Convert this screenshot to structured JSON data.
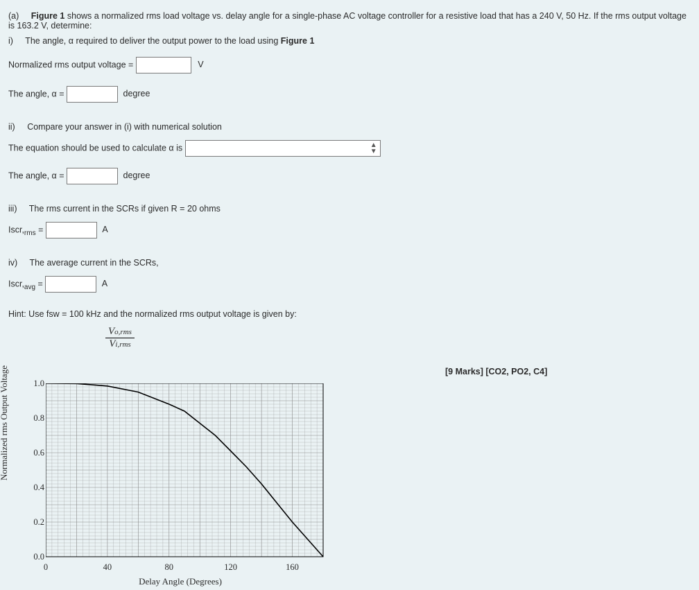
{
  "intro": {
    "label_a": "(a)",
    "text1_prefix": " shows a normalized rms load voltage vs. delay angle for a single-phase AC voltage controller for a resistive load that has a 240 V, 50 Hz. If the rms output voltage is 163.2 V, determine:",
    "fig1": "Figure 1"
  },
  "parts": {
    "i": {
      "label": "i)",
      "text": "The angle, α required to deliver the output power to the load using ",
      "fig": "Figure 1"
    },
    "norm_label": "Normalized rms output voltage = ",
    "norm_unit": "V",
    "angle_label": "The angle, α = ",
    "angle_unit": "degree",
    "ii": {
      "label": "ii)",
      "text": "Compare your answer in (i) with numerical solution"
    },
    "eq_label": "The equation should be used to calculate α is ",
    "iii": {
      "label": "iii)",
      "text": "The rms current in the SCRs if given R = 20 ohms"
    },
    "iscr_rms_label": "Iscr,",
    "iscr_rms_sub": "rms",
    "iscr_rms_post": " = ",
    "iv": {
      "label": "iv)",
      "text": "The average current in the SCRs,"
    },
    "iscr_avg_label": "Iscr,",
    "iscr_avg_sub": "avg",
    "iscr_avg_post": " = ",
    "A": "A"
  },
  "hint": {
    "text": "Hint: Use fsw = 100 kHz and the normalized rms output voltage is given by:",
    "frac_num1": "V",
    "frac_num_sub": "o,rms",
    "frac_den1": "V",
    "frac_den_sub": "i,rms"
  },
  "marks": "[9 Marks] [CO2, PO2, C4]",
  "chart_data": {
    "type": "line",
    "xlabel": "Delay Angle (Degrees)",
    "ylabel": "Normalized rms Output Voltage",
    "xlim": [
      0,
      180
    ],
    "ylim": [
      0,
      1.0
    ],
    "xticks": [
      0,
      40,
      80,
      120,
      160
    ],
    "yticks": [
      0.0,
      0.2,
      0.4,
      0.6,
      0.8,
      1.0
    ],
    "x": [
      0,
      20,
      40,
      60,
      80,
      90,
      100,
      110,
      120,
      130,
      140,
      150,
      160,
      170,
      180
    ],
    "y": [
      1.0,
      0.999,
      0.985,
      0.95,
      0.88,
      0.84,
      0.77,
      0.7,
      0.61,
      0.52,
      0.42,
      0.31,
      0.2,
      0.1,
      0.0
    ]
  }
}
